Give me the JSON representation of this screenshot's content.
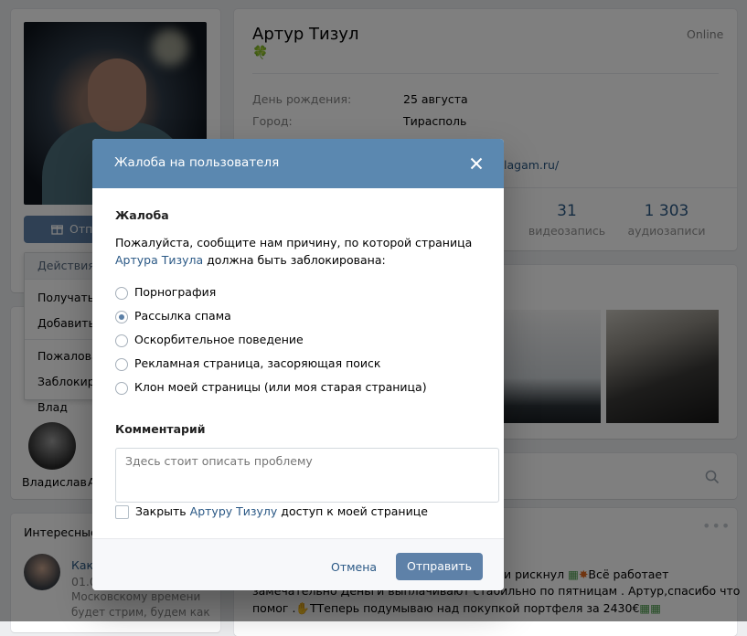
{
  "profile": {
    "name": "Артур Тизул",
    "status_emoji": "🍀",
    "online": "Online",
    "info": [
      {
        "label": "День рождения:",
        "value": "25 августа"
      },
      {
        "label": "Город:",
        "value": "Тирасполь"
      }
    ],
    "website_fragment": "lagam.ru/",
    "counters": [
      {
        "number": "31",
        "label": "видеозапись"
      },
      {
        "number": "1 303",
        "label": "аудиозаписи"
      }
    ]
  },
  "left": {
    "gift_button": "Отп",
    "actions_header": "Действия",
    "actions": [
      "Получать у",
      "Добавить",
      "Пожалова",
      "Заблокиро"
    ],
    "friend_top": "Влад",
    "friend_bottom": "Владислав",
    "friend_bottom_initial": "А",
    "interesting_title": "Интересные",
    "post_title": "Как",
    "post_date": "01.0",
    "post_text_1": "Московскому времени",
    "post_text_2": "будет стрим, будем как"
  },
  "feed": {
    "line1_a": "и рискнул",
    "line1_b": "Всё работает",
    "line2": "замечательно Деньги выплачивают стабильно по пятницам . Артур,спасибо что",
    "line3_a": "помог .",
    "line3_b": "ТТеперь подумываю над покупкой портфеля за 2430€"
  },
  "modal": {
    "title": "Жалоба на пользователя",
    "complaint_heading": "Жалоба",
    "description_before": "Пожалуйста, сообщите нам причину, по которой страница ",
    "description_link": "Артура Тизула",
    "description_after": " должна быть заблокирована:",
    "reasons": [
      {
        "label": "Порнография",
        "selected": false
      },
      {
        "label": "Рассылка спама",
        "selected": true
      },
      {
        "label": "Оскорбительное поведение",
        "selected": false
      },
      {
        "label": "Рекламная страница, засоряющая поиск",
        "selected": false
      },
      {
        "label": "Клон моей страницы (или моя старая страница)",
        "selected": false
      }
    ],
    "comment_heading": "Комментарий",
    "comment_placeholder": "Здесь стоит описать проблему",
    "close_access_before": "Закрыть ",
    "close_access_link": "Артуру Тизулу",
    "close_access_after": " доступ к моей странице",
    "close_access_checked": false,
    "cancel": "Отмена",
    "submit": "Отправить"
  },
  "colors": {
    "header": "#5b88b0",
    "button": "#5e81a8",
    "link": "#2a5885",
    "background": "#edeef0"
  }
}
